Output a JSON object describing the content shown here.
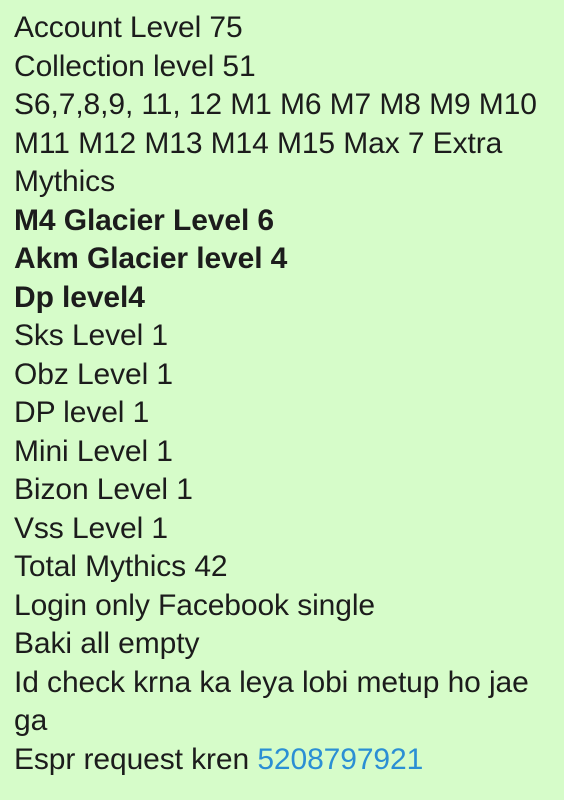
{
  "note": {
    "background_color": "#d6fcc9",
    "text_color": "#1c1c1c",
    "link_color": "#2b8fd4",
    "lines": [
      {
        "text": "Account Level 75",
        "bold": false
      },
      {
        "text": "Collection level 51",
        "bold": false
      },
      {
        "text": "S6,7,8,9, 11, 12 M1 M6 M7 M8 M9 M10 M11 M12 M13 M14 M15 Max 7 Extra Mythics",
        "bold": false
      },
      {
        "text": "M4 Glacier Level 6",
        "bold": true
      },
      {
        "text": "Akm Glacier level 4",
        "bold": true
      },
      {
        "text": "Dp level4",
        "bold": true
      },
      {
        "text": "Sks Level 1",
        "bold": false
      },
      {
        "text": "Obz Level 1",
        "bold": false
      },
      {
        "text": "DP level 1",
        "bold": false
      },
      {
        "text": "Mini Level 1",
        "bold": false
      },
      {
        "text": "Bizon Level 1",
        "bold": false
      },
      {
        "text": "Vss Level 1",
        "bold": false
      },
      {
        "text": "Total Mythics 42",
        "bold": false
      },
      {
        "text": "Login only Facebook single",
        "bold": false
      },
      {
        "text": "Baki all empty",
        "bold": false
      },
      {
        "text": "Id check krna ka leya lobi metup ho jae ga",
        "bold": false
      }
    ],
    "contact_line": {
      "prefix": "Espr request kren ",
      "phone": "5208797921"
    }
  }
}
